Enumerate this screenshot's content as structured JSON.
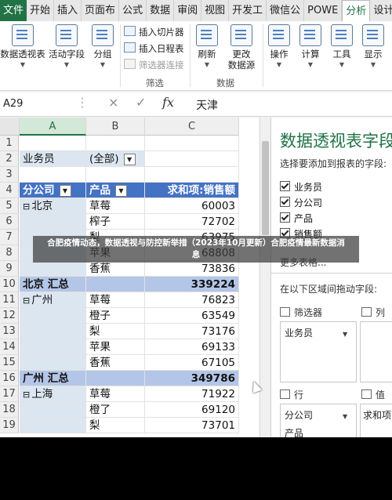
{
  "ribbon_tabs": [
    "文件",
    "开始",
    "插入",
    "页面布",
    "公式",
    "数据",
    "审阅",
    "视图",
    "开发工",
    "微信公",
    "POWE",
    "分析",
    "设计"
  ],
  "active_tab_index": 11,
  "ribbon": {
    "pivot_label": "数据透视表",
    "active_field_label": "活动字段",
    "group_label": "分组",
    "insert_slicer": "插入切片器",
    "insert_timeline": "插入日程表",
    "filter_connections": "筛选器连接",
    "filter_group_label": "筛选",
    "refresh_label": "刷新",
    "change_source_label_1": "更改",
    "change_source_label_2": "数据源",
    "data_group_label": "数据",
    "actions_label": "操作",
    "calc_label": "计算",
    "tools_label": "工具",
    "show_label": "显示"
  },
  "formula_bar": {
    "name_box": "A29",
    "value": "天津",
    "cancel_icon": "×",
    "enter_icon": "✓",
    "fx": "fx"
  },
  "columns": [
    "A",
    "B",
    "C"
  ],
  "rows": [
    {
      "n": "1",
      "a": "",
      "b": "",
      "c": "",
      "type": "blank"
    },
    {
      "n": "2",
      "a": "业务员",
      "b": "(全部)",
      "c": "",
      "type": "filter"
    },
    {
      "n": "3",
      "a": "",
      "b": "",
      "c": "",
      "type": "blank"
    },
    {
      "n": "4",
      "a": "分公司",
      "b": "产品",
      "c": "求和项:销售额",
      "type": "header"
    },
    {
      "n": "5",
      "a": "北京",
      "b": "草莓",
      "c": "60003",
      "type": "first"
    },
    {
      "n": "6",
      "a": "",
      "b": "榨子",
      "c": "72702",
      "type": "item"
    },
    {
      "n": "7",
      "a": "",
      "b": "梨",
      "c": "63975",
      "type": "item"
    },
    {
      "n": "8",
      "a": "",
      "b": "苹果",
      "c": "68808",
      "type": "item"
    },
    {
      "n": "9",
      "a": "",
      "b": "香蕉",
      "c": "73836",
      "type": "item"
    },
    {
      "n": "10",
      "a": "北京 汇总",
      "b": "",
      "c": "339224",
      "type": "subtotal"
    },
    {
      "n": "11",
      "a": "广州",
      "b": "草莓",
      "c": "76823",
      "type": "first"
    },
    {
      "n": "12",
      "a": "",
      "b": "橙子",
      "c": "63549",
      "type": "item"
    },
    {
      "n": "13",
      "a": "",
      "b": "梨",
      "c": "73176",
      "type": "item"
    },
    {
      "n": "14",
      "a": "",
      "b": "苹果",
      "c": "69133",
      "type": "item"
    },
    {
      "n": "15",
      "a": "",
      "b": "香蕉",
      "c": "67105",
      "type": "item"
    },
    {
      "n": "16",
      "a": "广州 汇总",
      "b": "",
      "c": "349786",
      "type": "subtotal"
    },
    {
      "n": "17",
      "a": "上海",
      "b": "草莓",
      "c": "71922",
      "type": "first"
    },
    {
      "n": "18",
      "a": "",
      "b": "橙了",
      "c": "69120",
      "type": "item"
    },
    {
      "n": "19",
      "a": "",
      "b": "梨",
      "c": "73701",
      "type": "item"
    }
  ],
  "pane": {
    "title": "数据透视表字段",
    "subtitle": "选择要添加到报表的字段:",
    "fields": [
      {
        "label": "业务员",
        "checked": true
      },
      {
        "label": "分公司",
        "checked": true
      },
      {
        "label": "产品",
        "checked": true
      },
      {
        "label": "销售额",
        "checked": true
      }
    ],
    "more_tables": "更多表格...",
    "drag_hint": "在以下区域间拖动字段:",
    "filters_label": "筛选器",
    "columns_label": "列",
    "filter_item": "业务员",
    "rows_label": "行",
    "values_label": "值",
    "row_item_1": "分公司",
    "row_item_2": "产品",
    "value_item": "求和项"
  },
  "banner": {
    "line1": "合肥疫情动态，数据透视与防控新举措（2023年10月更新）合肥疫情最新数据消",
    "line2": "息"
  }
}
